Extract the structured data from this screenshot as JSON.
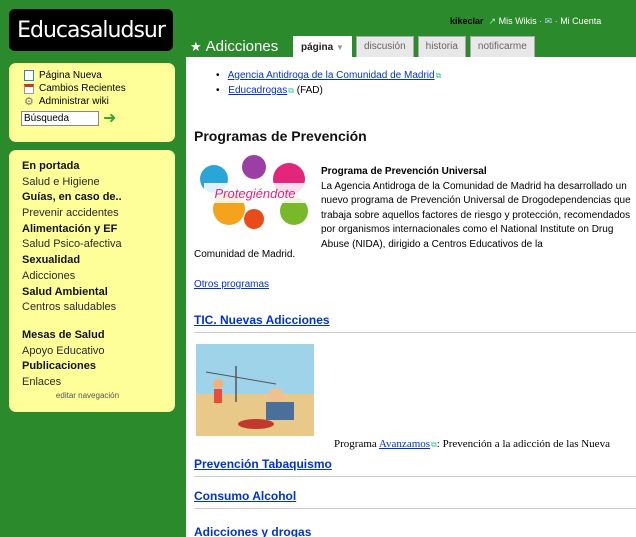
{
  "logo": "Educasaludsur",
  "tools": [
    {
      "label": "Página Nueva",
      "icon": "new-page-icon",
      "color": "#3a7bd5"
    },
    {
      "label": "Cambios Recientes",
      "icon": "calendar-icon",
      "color": "#c0392b"
    },
    {
      "label": "Administrar wiki",
      "icon": "gear-icon",
      "color": "#888888"
    }
  ],
  "search": {
    "placeholder": "Búsqueda"
  },
  "nav": [
    {
      "label": "En portada",
      "bold": true
    },
    {
      "label": "Salud e Higiene",
      "bold": false
    },
    {
      "label": "Guías, en caso de..",
      "bold": true
    },
    {
      "label": "Prevenir accidentes",
      "bold": false
    },
    {
      "label": "Alimentación y EF",
      "bold": true
    },
    {
      "label": "Salud Psico-afectiva",
      "bold": false
    },
    {
      "label": "Sexualidad",
      "bold": true
    },
    {
      "label": "Adicciones",
      "bold": false
    },
    {
      "label": "Salud Ambiental",
      "bold": true
    },
    {
      "label": "Centros saludables",
      "bold": false
    },
    {
      "label": "Mesas de Salud",
      "bold": true
    },
    {
      "label": "Apoyo Educativo",
      "bold": false
    },
    {
      "label": "Publicaciones",
      "bold": true
    },
    {
      "label": "Enlaces",
      "bold": false
    }
  ],
  "edit_nav": "editar navegación",
  "userbar": {
    "user": "kikeclar",
    "wikis": "Mis Wikis",
    "account": "Mi Cuenta"
  },
  "page_title": "Adicciones",
  "tabs": [
    "página",
    "discusión",
    "historia",
    "notificarme"
  ],
  "links": [
    {
      "text": "Agencia Antidroga de la Comunidad de Madrid",
      "suffix": ""
    },
    {
      "text": "Educadrogas",
      "suffix": "(FAD)"
    }
  ],
  "sections": {
    "prevencion": "Programas de Prevención",
    "tic": "TIC. Nuevas Adicciones",
    "tabaco": "Prevención Tabaquismo",
    "alcohol": "Consumo Alcohol",
    "drogas": "Adicciones y drogas"
  },
  "programa": {
    "title": "Programa de Prevención Universal",
    "body": "La Agencia Antidroga de la Comunidad de Madrid ha desarrollado un nuevo programa de Prevención Universal de Drogodependencias que trabaja sobre aquellos factores de riesgo y protección, recomendados por organismos internacionales como el National Institute on Drug Abuse (NIDA), dirigido a Centros Educativos de la",
    "tail": "Comunidad de Madrid.",
    "image_text": "Protegiéndote"
  },
  "otros_programas": "Otros programas",
  "avanzamos": {
    "prefix": "Programa",
    "link": "Avanzamos",
    "suffix": ": Prevención a la adicción de las Nueva"
  }
}
